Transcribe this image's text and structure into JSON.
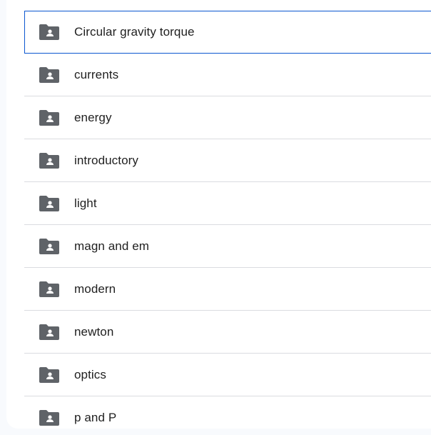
{
  "folders": [
    {
      "name": "Circular gravity torque",
      "icon": "shared-folder-icon",
      "selected": true
    },
    {
      "name": "currents",
      "icon": "shared-folder-icon"
    },
    {
      "name": "energy",
      "icon": "shared-folder-icon"
    },
    {
      "name": "introductory",
      "icon": "shared-folder-icon"
    },
    {
      "name": "light",
      "icon": "shared-folder-icon"
    },
    {
      "name": "magn and em",
      "icon": "shared-folder-icon"
    },
    {
      "name": "modern",
      "icon": "shared-folder-icon"
    },
    {
      "name": "newton",
      "icon": "shared-folder-icon"
    },
    {
      "name": "optics",
      "icon": "shared-folder-icon"
    },
    {
      "name": "p and P",
      "icon": "shared-folder-icon"
    }
  ],
  "colors": {
    "icon": "#5f6368",
    "selected_border": "#0b57d0",
    "divider": "#dadce0",
    "text": "#1f1f1f"
  }
}
